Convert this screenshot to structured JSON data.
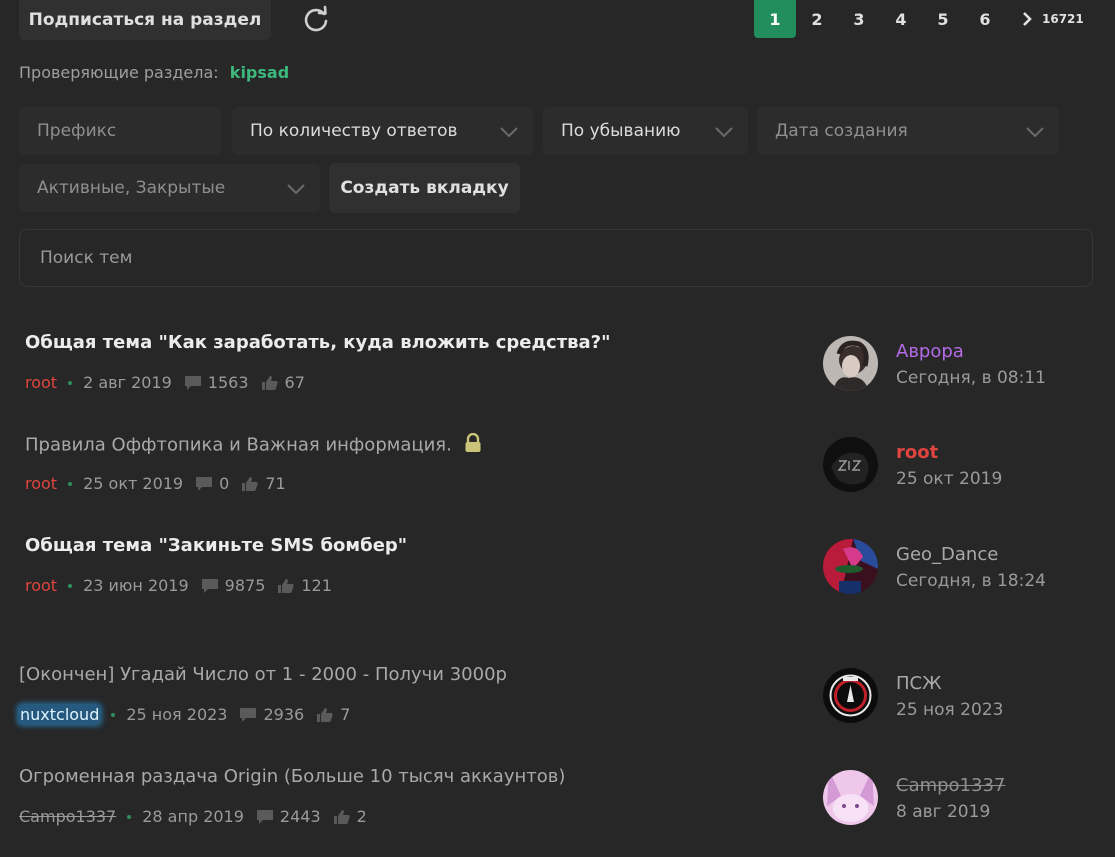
{
  "header": {
    "subscribe_label": "Подписаться на раздел",
    "refresh_icon": "refresh-icon"
  },
  "pagination": {
    "pages": [
      "1",
      "2",
      "3",
      "4",
      "5",
      "6"
    ],
    "active_page": "1",
    "next_icon": "chevron-right-icon",
    "last_page": "16721"
  },
  "reviewers": {
    "label": "Проверяющие раздела:",
    "name": "kipsad"
  },
  "filters": {
    "prefix_placeholder": "Префикс",
    "sort_by": "По количеству ответов",
    "order": "По убыванию",
    "date_placeholder": "Дата создания",
    "state": "Активные, Закрытые",
    "create_tab_label": "Создать вкладку"
  },
  "search": {
    "placeholder": "Поиск тем"
  },
  "colors": {
    "accent_green": "#228e5d",
    "reviewer_green": "#3cb87c",
    "author_red": "#e0443e",
    "user_purple": "#b36be8"
  },
  "threads": [
    {
      "title": "Общая тема \"Как заработать, куда вложить средства?\"",
      "author": "root",
      "date": "2 авг 2019",
      "replies": "1563",
      "likes": "67",
      "last_user": "Аврора",
      "last_date": "Сегодня, в 08:11"
    },
    {
      "title": "Правила Оффтопика и Важная информация.",
      "author": "root",
      "date": "25 окт 2019",
      "replies": "0",
      "likes": "71",
      "last_user": "root",
      "last_date": "25 окт 2019"
    },
    {
      "title": "Общая тема \"Закиньте SMS бомбер\"",
      "author": "root",
      "date": "23 июн 2019",
      "replies": "9875",
      "likes": "121",
      "last_user": "Geo_Dance",
      "last_date": "Сегодня, в 18:24"
    },
    {
      "title": "[Окончен] Угадай Число от 1 - 2000 - Получи 3000р",
      "author": "nuxtcloud",
      "date": "25 ноя 2023",
      "replies": "2936",
      "likes": "7",
      "last_user": "ПСЖ",
      "last_date": "25 ноя 2023"
    },
    {
      "title": "Огроменная раздача Origin (Больше 10 тысяч аккаунтов)",
      "author": "Campo1337",
      "date": "28 апр 2019",
      "replies": "2443",
      "likes": "2",
      "last_user": "Campo1337",
      "last_date": "8 авг 2019"
    }
  ]
}
